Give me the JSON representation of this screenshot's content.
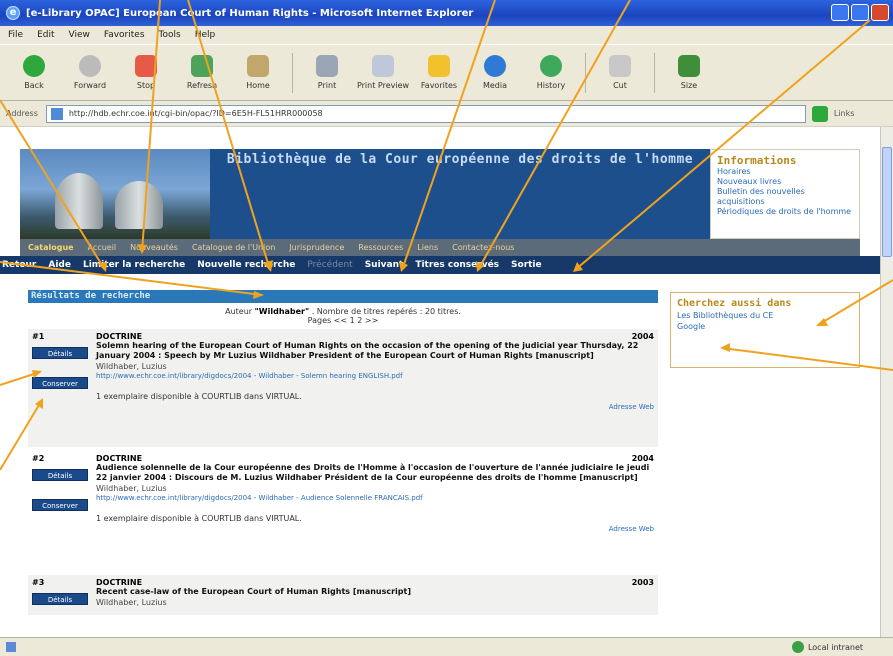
{
  "window": {
    "title": "[e-Library OPAC] European Court of Human Rights - Microsoft Internet Explorer"
  },
  "menu": [
    "File",
    "Edit",
    "View",
    "Favorites",
    "Tools",
    "Help"
  ],
  "toolbar": {
    "back": "Back",
    "forward": "Forward",
    "stop": "Stop",
    "refresh": "Refresh",
    "home": "Home",
    "print": "Print",
    "print_preview": "Print Preview",
    "favorites": "Favorites",
    "media": "Media",
    "history": "History",
    "cut": "Cut",
    "size": "Size"
  },
  "address": {
    "label": "Address",
    "url": "http://hdb.echr.coe.int/cgi-bin/opac/?ID=6E5H-FL51HRR000058",
    "links": "Links"
  },
  "site": {
    "title": "Bibliothèque de la Cour européenne des droits de l'homme"
  },
  "info": {
    "heading": "Informations",
    "links": [
      "Horaires",
      "Nouveaux livres",
      "Bulletin des nouvelles acquisitions",
      "Périodiques de droits de l'homme"
    ]
  },
  "nav1": {
    "items": [
      "Catalogue",
      "Accueil",
      "Nouveautés",
      "Catalogue de l'Union",
      "Jurisprudence",
      "Ressources",
      "Liens",
      "Contactez-nous"
    ]
  },
  "nav2": {
    "items": [
      "Retour",
      "Aide",
      "Limiter la recherche",
      "Nouvelle recherche",
      "Précédent",
      "Suivant",
      "Titres conservés",
      "Sortie"
    ]
  },
  "results": {
    "heading": "Résultats de recherche",
    "summary_prefix": "Auteur",
    "summary_query": "\"Wildhaber\"",
    "summary_suffix": ". Nombre de titres repérés : 20 titres.",
    "pages": "Pages << 1 2 >>",
    "details_label": "Détails",
    "conserver_label": "Conserver",
    "web_label": "Adresse Web",
    "records": [
      {
        "num": "#1",
        "type": "DOCTRINE",
        "year": "2004",
        "title": "Solemn hearing of the European Court of Human Rights on the occasion of the opening of the judicial year Thursday, 22 January 2004 : Speech by Mr Luzius Wildhaber President of the European Court of Human Rights [manuscript]",
        "author": "Wildhaber, Luzius",
        "url": "http://www.echr.coe.int/library/digdocs/2004 - Wildhaber - Solemn hearing ENGLISH.pdf",
        "availability": "1 exemplaire disponible à COURTLIB dans VIRTUAL."
      },
      {
        "num": "#2",
        "type": "DOCTRINE",
        "year": "2004",
        "title": "Audience solennelle de la Cour européenne des Droits de l'Homme à l'occasion de l'ouverture de l'année judiciaire le jeudi 22 janvier 2004 : Discours de M. Luzius Wildhaber Président de la Cour européenne des droits de l'homme [manuscript]",
        "author": "Wildhaber, Luzius",
        "url": "http://www.echr.coe.int/library/digdocs/2004 - Wildhaber - Audience Solennelle FRANCAIS.pdf",
        "availability": "1 exemplaire disponible à COURTLIB dans VIRTUAL."
      },
      {
        "num": "#3",
        "type": "DOCTRINE",
        "year": "2003",
        "title": "Recent case-law of the European Court of Human Rights [manuscript]",
        "author": "Wildhaber, Luzius",
        "url": "",
        "availability": ""
      }
    ]
  },
  "cherchez": {
    "heading": "Cherchez aussi dans",
    "links": [
      "Les Bibliothèques du CE",
      "Google"
    ]
  },
  "status": {
    "zone": "Local intranet"
  },
  "colors": {
    "annotation_arrow": "#f0a21e",
    "header_blue": "#1d4f8c",
    "nav_dark": "#163969"
  }
}
